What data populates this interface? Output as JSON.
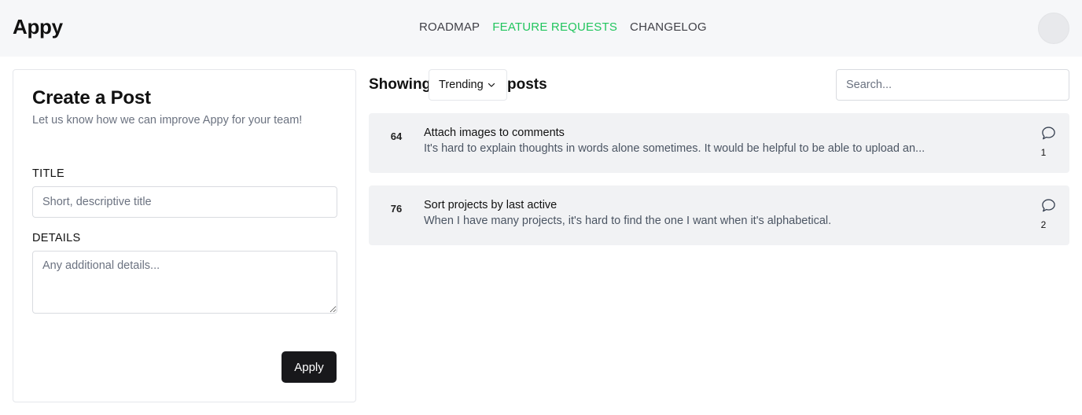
{
  "header": {
    "logo": "Appy",
    "nav": [
      {
        "label": "ROADMAP",
        "active": false
      },
      {
        "label": "FEATURE REQUESTS",
        "active": true
      },
      {
        "label": "CHANGELOG",
        "active": false
      }
    ],
    "accent_color": "#22c55e"
  },
  "create_post": {
    "title": "Create a Post",
    "subtitle": "Let us know how we can improve Appy for your team!",
    "title_label": "TITLE",
    "title_placeholder": "Short, descriptive title",
    "details_label": "DETAILS",
    "details_placeholder": "Any additional details...",
    "submit_label": "Apply"
  },
  "feed": {
    "showing_prefix": "Showing",
    "sort_value": "Trending",
    "showing_suffix": "posts",
    "search_placeholder": "Search...",
    "posts": [
      {
        "votes": "64",
        "title": "Attach images to comments",
        "description": "It's hard to explain thoughts in words alone sometimes. It would be helpful to be able to upload an...",
        "comments": "1",
        "icon": "comment-icon"
      },
      {
        "votes": "76",
        "title": "Sort projects by last active",
        "description": "When I have many projects, it's hard to find the one I want when it's alphabetical.",
        "comments": "2",
        "icon": "comment-icon"
      }
    ]
  }
}
